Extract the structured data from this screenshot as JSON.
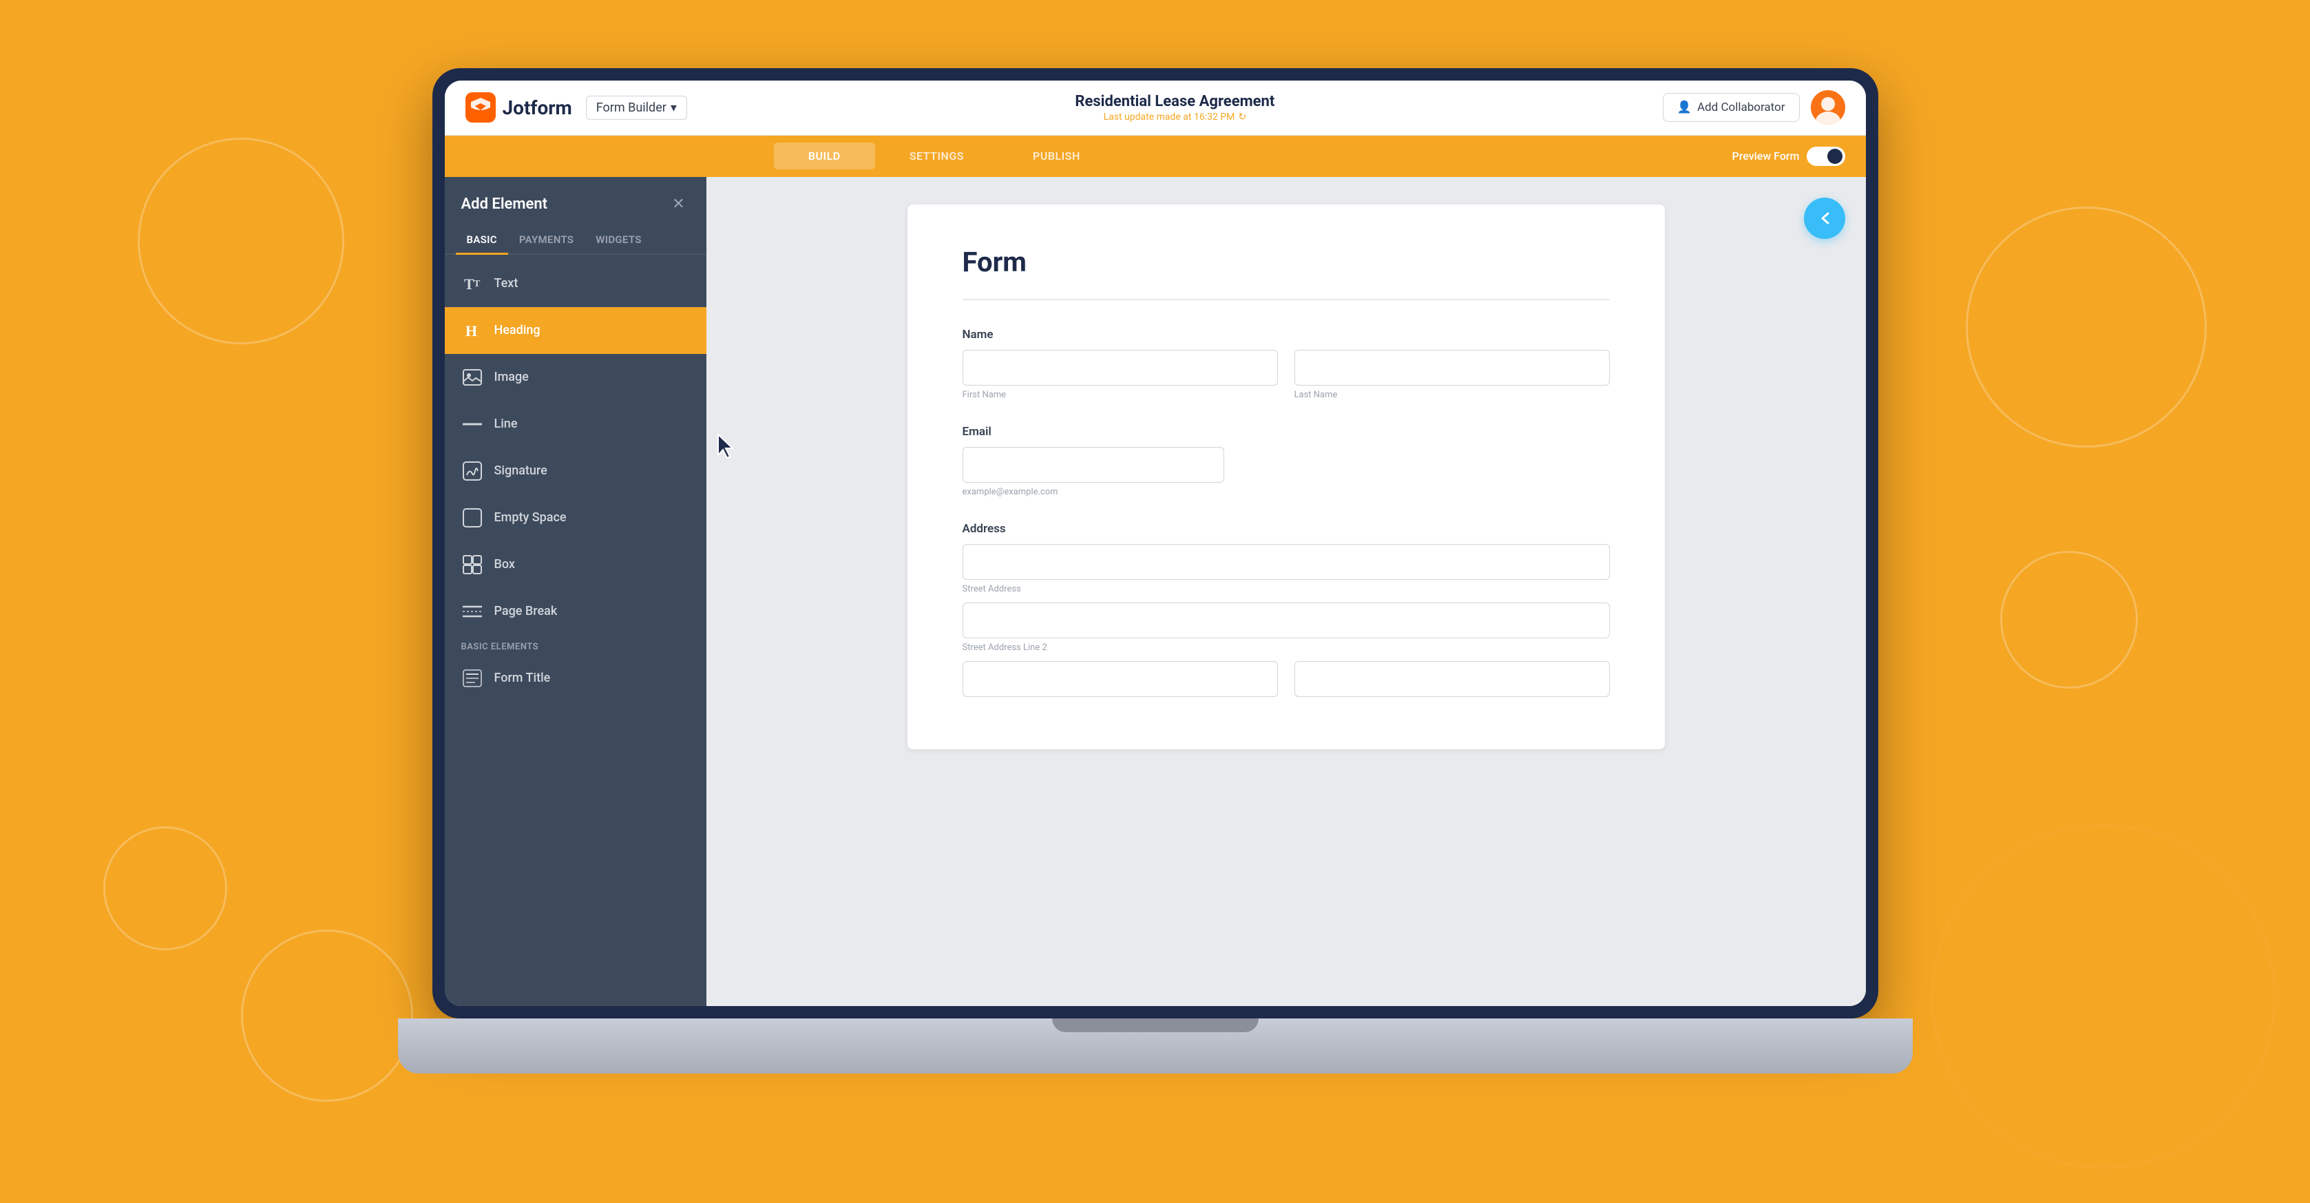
{
  "app": {
    "name": "Jotform",
    "logo_text": "Jotform"
  },
  "topbar": {
    "form_builder_label": "Form Builder",
    "form_title": "Residential Lease Agreement",
    "last_update": "Last update made at 16:32 PM",
    "add_collaborator_label": "Add Collaborator"
  },
  "navbar": {
    "tabs": [
      {
        "id": "build",
        "label": "BUILD",
        "active": true
      },
      {
        "id": "settings",
        "label": "SETTINGS",
        "active": false
      },
      {
        "id": "publish",
        "label": "PUBLISH",
        "active": false
      }
    ],
    "preview_label": "Preview Form"
  },
  "sidebar": {
    "title": "Add Element",
    "tabs": [
      {
        "id": "basic",
        "label": "BASIC",
        "active": true
      },
      {
        "id": "payments",
        "label": "PAYMENTS",
        "active": false
      },
      {
        "id": "widgets",
        "label": "WIDGETS",
        "active": false
      }
    ],
    "items": [
      {
        "id": "text",
        "label": "Text",
        "icon": "T",
        "active": false
      },
      {
        "id": "heading",
        "label": "Heading",
        "icon": "H",
        "active": true
      },
      {
        "id": "image",
        "label": "Image",
        "icon": "img",
        "active": false
      },
      {
        "id": "line",
        "label": "Line",
        "icon": "line",
        "active": false
      },
      {
        "id": "signature",
        "label": "Signature",
        "icon": "sig",
        "active": false
      },
      {
        "id": "empty-space",
        "label": "Empty Space",
        "icon": "sq",
        "active": false
      },
      {
        "id": "box",
        "label": "Box",
        "icon": "box",
        "active": false
      },
      {
        "id": "page-break",
        "label": "Page Break",
        "icon": "pb",
        "active": false
      }
    ],
    "section_label": "BASIC ELEMENTS",
    "basic_elements": [
      {
        "id": "form-title",
        "label": "Form Title",
        "icon": "ft",
        "active": false
      }
    ]
  },
  "form": {
    "title": "Form",
    "fields": [
      {
        "id": "name",
        "label": "Name",
        "type": "name",
        "subfields": [
          {
            "id": "first-name",
            "placeholder": "",
            "hint": "First Name"
          },
          {
            "id": "last-name",
            "placeholder": "",
            "hint": "Last Name"
          }
        ]
      },
      {
        "id": "email",
        "label": "Email",
        "type": "email",
        "placeholder": "",
        "hint": "example@example.com"
      },
      {
        "id": "address",
        "label": "Address",
        "type": "address",
        "lines": [
          {
            "id": "street1",
            "hint": "Street Address"
          },
          {
            "id": "street2",
            "hint": "Street Address Line 2"
          },
          {
            "id": "city",
            "hint": ""
          },
          {
            "id": "state",
            "hint": ""
          }
        ]
      }
    ]
  }
}
